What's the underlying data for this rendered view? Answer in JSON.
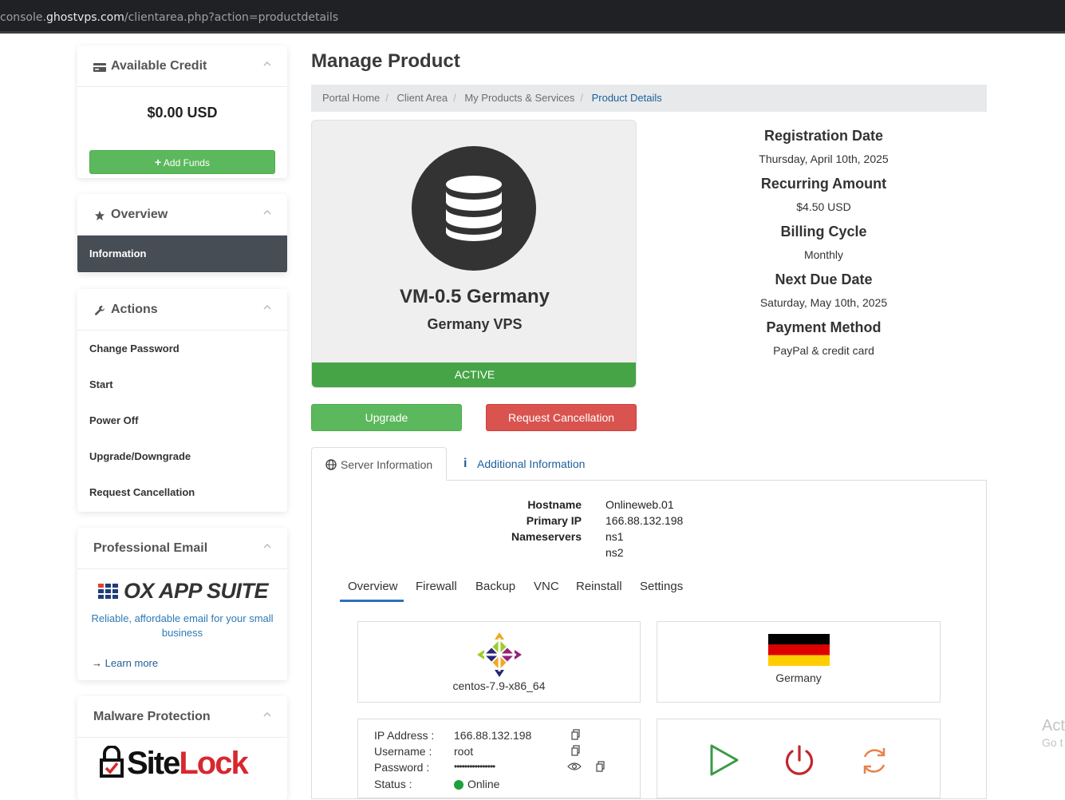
{
  "browser": {
    "url_prefix": "console.",
    "url_host": "ghostvps.com",
    "url_path": "/clientarea.php?action=productdetails"
  },
  "sidebar": {
    "credit": {
      "title": "Available Credit",
      "value": "$0.00 USD",
      "add_funds": "Add Funds"
    },
    "overview": {
      "title": "Overview",
      "items": [
        "Information"
      ]
    },
    "actions": {
      "title": "Actions",
      "items": [
        "Change Password",
        "Start",
        "Power Off",
        "Upgrade/Downgrade",
        "Request Cancellation"
      ]
    },
    "email": {
      "title": "Professional Email",
      "brand": "OX APP SUITE",
      "description": "Reliable, affordable email for your small business",
      "learn_more": "Learn more"
    },
    "malware": {
      "title": "Malware Protection",
      "brand_a": "Site",
      "brand_b": "Lock"
    }
  },
  "main": {
    "title": "Manage Product",
    "breadcrumb": [
      "Portal Home",
      "Client Area",
      "My Products & Services",
      "Product Details"
    ],
    "product": {
      "name": "VM-0.5 Germany",
      "group": "Germany VPS",
      "status": "ACTIVE"
    },
    "buttons": {
      "upgrade": "Upgrade",
      "cancel": "Request Cancellation"
    },
    "details": [
      {
        "label": "Registration Date",
        "value": "Thursday, April 10th, 2025"
      },
      {
        "label": "Recurring Amount",
        "value": "$4.50 USD"
      },
      {
        "label": "Billing Cycle",
        "value": "Monthly"
      },
      {
        "label": "Next Due Date",
        "value": "Saturday, May 10th, 2025"
      },
      {
        "label": "Payment Method",
        "value": "PayPal & credit card"
      }
    ],
    "tabs": {
      "server": "Server Information",
      "additional": "Additional Information"
    },
    "server": {
      "hostname_label": "Hostname",
      "hostname": "Onlineweb.01",
      "ip_label": "Primary IP",
      "ip": "166.88.132.198",
      "ns_label": "Nameservers",
      "ns1": "ns1",
      "ns2": "ns2"
    },
    "subnav": [
      "Overview",
      "Firewall",
      "Backup",
      "VNC",
      "Reinstall",
      "Settings"
    ],
    "os": "centos-7.9-x86_64",
    "location": "Germany",
    "credentials": {
      "ip_label": "IP Address :",
      "ip": "166.88.132.198",
      "user_label": "Username :",
      "user": "root",
      "pass_label": "Password :",
      "pass": "••••••••••••••••",
      "status_label": "Status :",
      "status": "Online"
    },
    "colors": {
      "start": "#3a9a47",
      "power": "#c0262d",
      "restart": "#e8824a"
    }
  },
  "os_watermark": {
    "line1": "Act",
    "line2": "Go t"
  }
}
